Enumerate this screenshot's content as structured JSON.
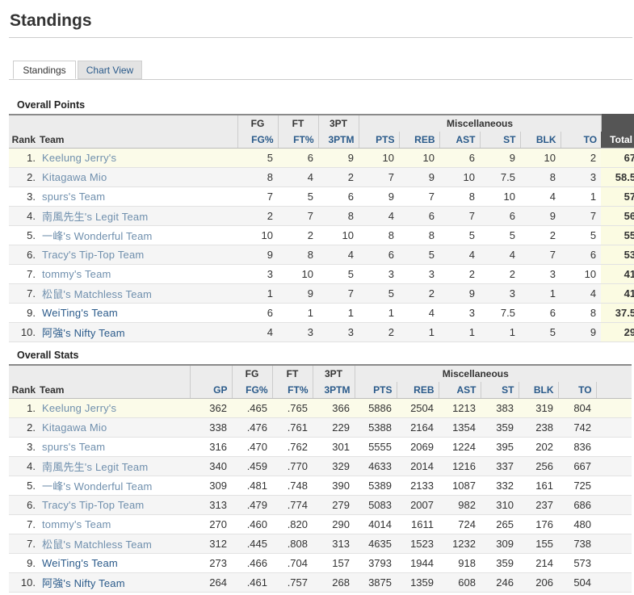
{
  "page_title": "Standings",
  "tabs": [
    {
      "label": "Standings",
      "active": true
    },
    {
      "label": "Chart View",
      "active": false
    }
  ],
  "overall_points": {
    "title": "Overall Points",
    "groups": {
      "fg": "FG",
      "ft": "FT",
      "tpt": "3PT",
      "misc": "Miscellaneous"
    },
    "columns": {
      "rank": "Rank",
      "team": "Team",
      "fgp": "FG%",
      "ftp": "FT%",
      "tpm": "3PTM",
      "pts": "PTS",
      "reb": "REB",
      "ast": "AST",
      "st": "ST",
      "blk": "BLK",
      "to": "TO",
      "total": "Total"
    },
    "rows": [
      {
        "rank": "1.",
        "team": "Keelung Jerry's",
        "fgp": "5",
        "ftp": "6",
        "tpm": "9",
        "pts": "10",
        "reb": "10",
        "ast": "6",
        "st": "9",
        "blk": "10",
        "to": "2",
        "total": "67"
      },
      {
        "rank": "2.",
        "team": "Kitagawa Mio",
        "fgp": "8",
        "ftp": "4",
        "tpm": "2",
        "pts": "7",
        "reb": "9",
        "ast": "10",
        "st": "7.5",
        "blk": "8",
        "to": "3",
        "total": "58.5"
      },
      {
        "rank": "3.",
        "team": "spurs's Team",
        "fgp": "7",
        "ftp": "5",
        "tpm": "6",
        "pts": "9",
        "reb": "7",
        "ast": "8",
        "st": "10",
        "blk": "4",
        "to": "1",
        "total": "57"
      },
      {
        "rank": "4.",
        "team": "南風先生's Legit Team",
        "fgp": "2",
        "ftp": "7",
        "tpm": "8",
        "pts": "4",
        "reb": "6",
        "ast": "7",
        "st": "6",
        "blk": "9",
        "to": "7",
        "total": "56"
      },
      {
        "rank": "5.",
        "team": "一峰's Wonderful Team",
        "fgp": "10",
        "ftp": "2",
        "tpm": "10",
        "pts": "8",
        "reb": "8",
        "ast": "5",
        "st": "5",
        "blk": "2",
        "to": "5",
        "total": "55"
      },
      {
        "rank": "6.",
        "team": "Tracy's Tip-Top Team",
        "fgp": "9",
        "ftp": "8",
        "tpm": "4",
        "pts": "6",
        "reb": "5",
        "ast": "4",
        "st": "4",
        "blk": "7",
        "to": "6",
        "total": "53"
      },
      {
        "rank": "7.",
        "team": "tommy's Team",
        "fgp": "3",
        "ftp": "10",
        "tpm": "5",
        "pts": "3",
        "reb": "3",
        "ast": "2",
        "st": "2",
        "blk": "3",
        "to": "10",
        "total": "41"
      },
      {
        "rank": "7.",
        "team": "松鼠's Matchless Team",
        "fgp": "1",
        "ftp": "9",
        "tpm": "7",
        "pts": "5",
        "reb": "2",
        "ast": "9",
        "st": "3",
        "blk": "1",
        "to": "4",
        "total": "41"
      },
      {
        "rank": "9.",
        "team": "WeiTing's Team",
        "fgp": "6",
        "ftp": "1",
        "tpm": "1",
        "pts": "1",
        "reb": "4",
        "ast": "3",
        "st": "7.5",
        "blk": "6",
        "to": "8",
        "total": "37.5"
      },
      {
        "rank": "10.",
        "team": "阿強's Nifty Team",
        "fgp": "4",
        "ftp": "3",
        "tpm": "3",
        "pts": "2",
        "reb": "1",
        "ast": "1",
        "st": "1",
        "blk": "5",
        "to": "9",
        "total": "29"
      }
    ]
  },
  "overall_stats": {
    "title": "Overall Stats",
    "groups": {
      "fg": "FG",
      "ft": "FT",
      "tpt": "3PT",
      "misc": "Miscellaneous"
    },
    "columns": {
      "rank": "Rank",
      "team": "Team",
      "gp": "GP",
      "fgp": "FG%",
      "ftp": "FT%",
      "tpm": "3PTM",
      "pts": "PTS",
      "reb": "REB",
      "ast": "AST",
      "st": "ST",
      "blk": "BLK",
      "to": "TO"
    },
    "rows": [
      {
        "rank": "1.",
        "team": "Keelung Jerry's",
        "gp": "362",
        "fgp": ".465",
        "ftp": ".765",
        "tpm": "366",
        "pts": "5886",
        "reb": "2504",
        "ast": "1213",
        "st": "383",
        "blk": "319",
        "to": "804"
      },
      {
        "rank": "2.",
        "team": "Kitagawa Mio",
        "gp": "338",
        "fgp": ".476",
        "ftp": ".761",
        "tpm": "229",
        "pts": "5388",
        "reb": "2164",
        "ast": "1354",
        "st": "359",
        "blk": "238",
        "to": "742"
      },
      {
        "rank": "3.",
        "team": "spurs's Team",
        "gp": "316",
        "fgp": ".470",
        "ftp": ".762",
        "tpm": "301",
        "pts": "5555",
        "reb": "2069",
        "ast": "1224",
        "st": "395",
        "blk": "202",
        "to": "836"
      },
      {
        "rank": "4.",
        "team": "南風先生's Legit Team",
        "gp": "340",
        "fgp": ".459",
        "ftp": ".770",
        "tpm": "329",
        "pts": "4633",
        "reb": "2014",
        "ast": "1216",
        "st": "337",
        "blk": "256",
        "to": "667"
      },
      {
        "rank": "5.",
        "team": "一峰's Wonderful Team",
        "gp": "309",
        "fgp": ".481",
        "ftp": ".748",
        "tpm": "390",
        "pts": "5389",
        "reb": "2133",
        "ast": "1087",
        "st": "332",
        "blk": "161",
        "to": "725"
      },
      {
        "rank": "6.",
        "team": "Tracy's Tip-Top Team",
        "gp": "313",
        "fgp": ".479",
        "ftp": ".774",
        "tpm": "279",
        "pts": "5083",
        "reb": "2007",
        "ast": "982",
        "st": "310",
        "blk": "237",
        "to": "686"
      },
      {
        "rank": "7.",
        "team": "tommy's Team",
        "gp": "270",
        "fgp": ".460",
        "ftp": ".820",
        "tpm": "290",
        "pts": "4014",
        "reb": "1611",
        "ast": "724",
        "st": "265",
        "blk": "176",
        "to": "480"
      },
      {
        "rank": "7.",
        "team": "松鼠's Matchless Team",
        "gp": "312",
        "fgp": ".445",
        "ftp": ".808",
        "tpm": "313",
        "pts": "4635",
        "reb": "1523",
        "ast": "1232",
        "st": "309",
        "blk": "155",
        "to": "738"
      },
      {
        "rank": "9.",
        "team": "WeiTing's Team",
        "gp": "273",
        "fgp": ".466",
        "ftp": ".704",
        "tpm": "157",
        "pts": "3793",
        "reb": "1944",
        "ast": "918",
        "st": "359",
        "blk": "214",
        "to": "573"
      },
      {
        "rank": "10.",
        "team": "阿強's Nifty Team",
        "gp": "264",
        "fgp": ".461",
        "ftp": ".757",
        "tpm": "268",
        "pts": "3875",
        "reb": "1359",
        "ast": "608",
        "st": "246",
        "blk": "206",
        "to": "504"
      }
    ]
  },
  "colors": {
    "link": "#2a5a8a",
    "link_muted": "#6f8fad",
    "total_header": "#555555",
    "highlight_row": "#fbfbe9"
  }
}
